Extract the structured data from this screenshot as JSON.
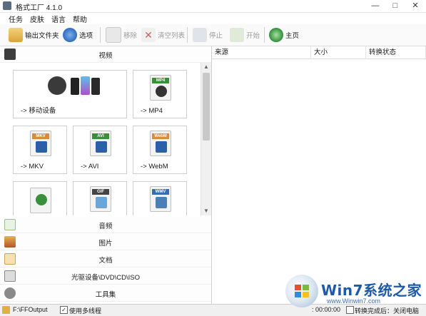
{
  "window": {
    "title": "格式工厂 4.1.0",
    "minimize": "—",
    "maximize": "□",
    "close": "✕"
  },
  "menu": [
    "任务",
    "皮肤",
    "语言",
    "帮助"
  ],
  "toolbar": {
    "output_folder": "输出文件夹",
    "options": "选项",
    "remove": "移除",
    "clear_list": "清空列表",
    "stop": "停止",
    "start": "开始",
    "home": "主页"
  },
  "categories": {
    "video": "视频",
    "audio": "音频",
    "image": "图片",
    "document": "文档",
    "disc": "光驱设备\\DVD\\CD\\ISO",
    "tools": "工具集"
  },
  "tiles": {
    "mobile": "-> 移动设备",
    "mp4": "-> MP4",
    "mkv": "-> MKV",
    "avi": "-> AVI",
    "webm": "-> WebM"
  },
  "badges": {
    "mp4": "MP4",
    "mkv": "MKV",
    "avi": "AVI",
    "webm": "WebM",
    "gif": "GIF",
    "wmv": "WMV"
  },
  "columns": [
    "来源",
    "大小",
    "转换状态"
  ],
  "status": {
    "output_path": "F:\\FFOutput",
    "multithread": "使用多线程",
    "elapsed": ": 00:00:00",
    "after_done": "转换完成后：关闭电脑"
  },
  "watermark": {
    "brand": "Win7系统之家",
    "url": "www.Winwin7.com"
  }
}
